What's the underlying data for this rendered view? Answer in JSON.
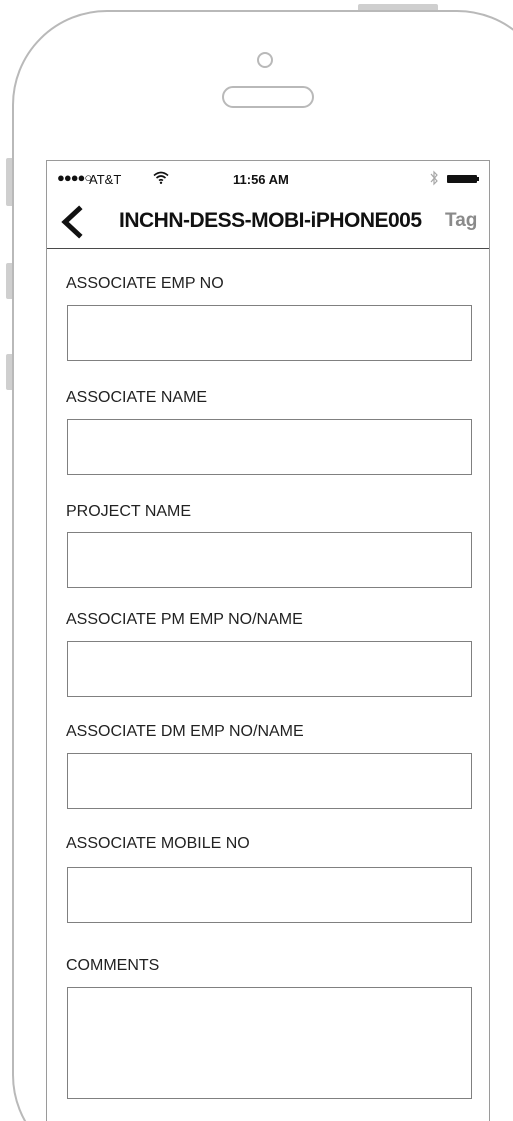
{
  "status_bar": {
    "signal": "●●●●○",
    "carrier": "AT&T",
    "wifi_icon": "wifi-icon",
    "time": "11:56 AM",
    "bluetooth_icon": "bluetooth-icon",
    "battery_icon": "battery-icon"
  },
  "nav": {
    "back_icon": "chevron-left-icon",
    "title": "INCHN-DESS-MOBI-iPHONE005",
    "action": "Tag"
  },
  "form": {
    "fields": [
      {
        "label": "ASSOCIATE EMP NO",
        "value": ""
      },
      {
        "label": "ASSOCIATE NAME",
        "value": ""
      },
      {
        "label": "PROJECT NAME",
        "value": ""
      },
      {
        "label": "ASSOCIATE PM EMP NO/NAME",
        "value": ""
      },
      {
        "label": "ASSOCIATE DM EMP NO/NAME",
        "value": ""
      },
      {
        "label": "ASSOCIATE MOBILE NO",
        "value": ""
      },
      {
        "label": "COMMENTS",
        "value": ""
      }
    ]
  },
  "colors": {
    "frame": "#b9b9b9",
    "text": "#111111",
    "action_text": "#8a8a8a",
    "input_border": "#808080"
  }
}
